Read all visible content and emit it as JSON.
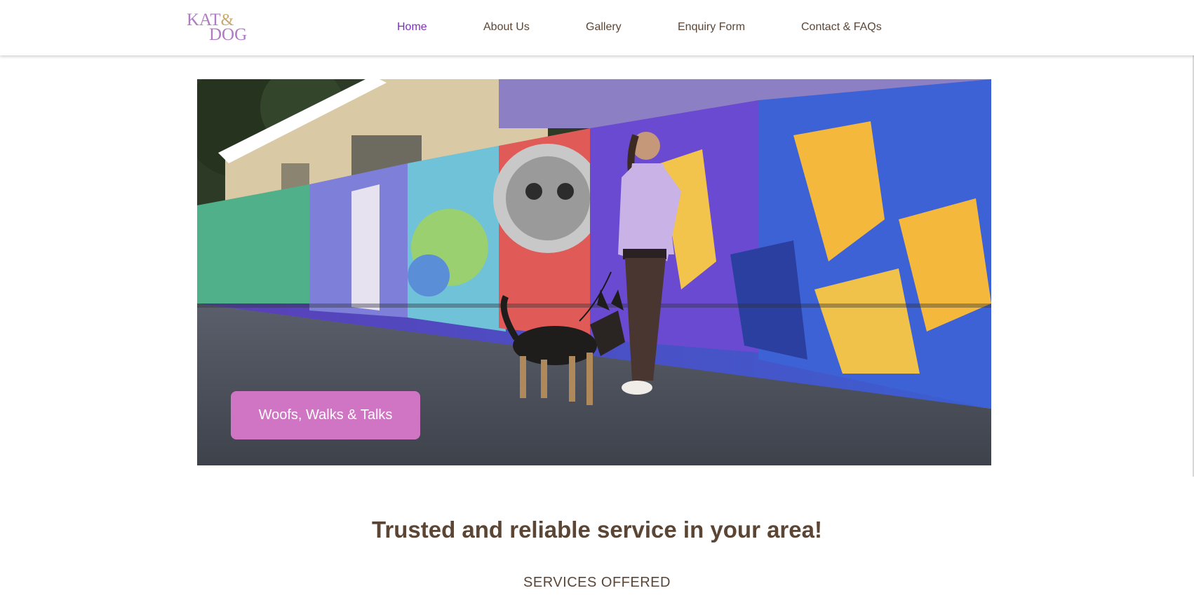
{
  "header": {
    "logo": {
      "line1": "KAT",
      "amp": "&",
      "line2": "DOG"
    },
    "nav": [
      {
        "label": "Home",
        "active": true
      },
      {
        "label": "About Us",
        "active": false
      },
      {
        "label": "Gallery",
        "active": false
      },
      {
        "label": "Enquiry Form",
        "active": false
      },
      {
        "label": "Contact & FAQs",
        "active": false
      }
    ]
  },
  "hero": {
    "button_label": "Woofs, Walks & Talks"
  },
  "main": {
    "tagline": "Trusted and reliable service in your area!",
    "services_heading": "SERVICES OFFERED"
  },
  "colors": {
    "accent": "#d074c4",
    "nav_active": "#7d2fc2",
    "text": "#5b4636",
    "logo_purple": "#b07ac4",
    "logo_gold": "#c9a86b"
  }
}
